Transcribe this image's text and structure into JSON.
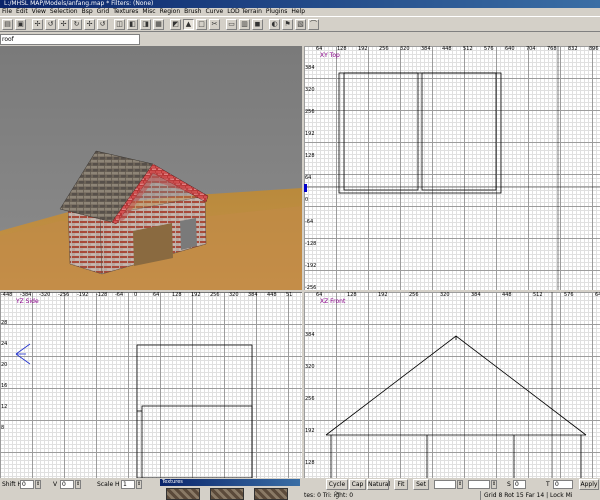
{
  "window": {
    "title": "L:/MHSL MAP/Models/anfang.map * Filters: (None)"
  },
  "menu": [
    "File",
    "Edit",
    "View",
    "Selection",
    "Bsp",
    "Grid",
    "Textures",
    "Misc",
    "Region",
    "Brush",
    "Curve",
    "LOD Terrain",
    "Plugins",
    "Help"
  ],
  "entity": {
    "value": "roof"
  },
  "views": {
    "xy": {
      "label": "XY Top",
      "xticks": [
        "64",
        "128",
        "192",
        "256",
        "320",
        "384",
        "448",
        "512",
        "576",
        "640",
        "704",
        "768",
        "832",
        "896"
      ],
      "yticks": [
        "384",
        "320",
        "256",
        "192",
        "128",
        "64",
        "0",
        "-64",
        "-128",
        "-192",
        "-256"
      ]
    },
    "yz": {
      "label": "YZ Side",
      "xticks": [
        "-448",
        "-384",
        "-320",
        "-256",
        "-192",
        "-128",
        "-64",
        "0",
        "64",
        "128",
        "192",
        "256",
        "320",
        "384",
        "448",
        "51"
      ],
      "yticks": [
        "28",
        "24",
        "20",
        "16",
        "12",
        "8"
      ]
    },
    "xz": {
      "label": "XZ Front",
      "xticks": [
        "64",
        "128",
        "192",
        "256",
        "320",
        "384",
        "448",
        "512",
        "576",
        "640"
      ],
      "yticks": [
        "384",
        "320",
        "256",
        "192",
        "128"
      ]
    }
  },
  "bottom": {
    "h_shift_label": "Shift H",
    "h_shift_value": "0",
    "v_label": "V",
    "v_value": "0",
    "scale_h_label": "Scale H",
    "scale_h_value": "1",
    "textures_title": "Textures",
    "cycle_label": "Cycle >",
    "cap_label": "Cap",
    "natural_label": "Natural",
    "fit_label": "Fit",
    "set_label": "Set",
    "s_label": "S",
    "s_value": "0",
    "t_label": "T",
    "t_value": "0",
    "apply_label": "Apply",
    "status_left": "tes: 0 Tri: ight: 0",
    "status_right": "Grid 8 Rot 15 Far 14 | Lock Mi"
  }
}
